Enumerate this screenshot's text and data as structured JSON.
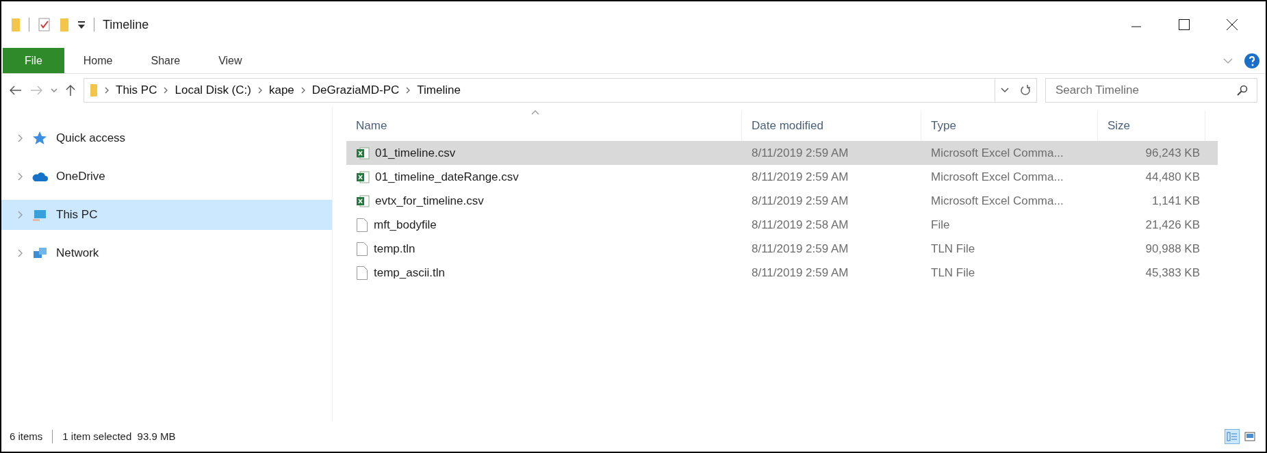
{
  "window": {
    "title": "Timeline"
  },
  "ribbon": {
    "tabs": [
      {
        "label": "File",
        "kind": "file"
      },
      {
        "label": "Home",
        "kind": "tab"
      },
      {
        "label": "Share",
        "kind": "tab"
      },
      {
        "label": "View",
        "kind": "tab"
      }
    ]
  },
  "address_bar": {
    "path": [
      "This PC",
      "Local Disk (C:)",
      "kape",
      "DeGraziaMD-PC",
      "Timeline"
    ]
  },
  "search": {
    "placeholder": "Search Timeline"
  },
  "sidebar": {
    "items": [
      {
        "label": "Quick access",
        "kind": "star",
        "selected": false
      },
      {
        "label": "OneDrive",
        "kind": "cloud",
        "selected": false
      },
      {
        "label": "This PC",
        "kind": "pc",
        "selected": true
      },
      {
        "label": "Network",
        "kind": "network",
        "selected": false
      }
    ]
  },
  "table": {
    "columns": [
      {
        "label": "Name",
        "sorted": true
      },
      {
        "label": "Date modified",
        "sorted": false
      },
      {
        "label": "Type",
        "sorted": false
      },
      {
        "label": "Size",
        "sorted": false
      }
    ],
    "rows": [
      {
        "name": "01_timeline.csv",
        "kind": "excel",
        "date": "8/11/2019 2:59 AM",
        "type": "Microsoft Excel Comma...",
        "size": "96,243 KB",
        "selected": true
      },
      {
        "name": "01_timeline_dateRange.csv",
        "kind": "excel",
        "date": "8/11/2019 2:59 AM",
        "type": "Microsoft Excel Comma...",
        "size": "44,480 KB",
        "selected": false
      },
      {
        "name": "evtx_for_timeline.csv",
        "kind": "excel",
        "date": "8/11/2019 2:59 AM",
        "type": "Microsoft Excel Comma...",
        "size": "1,141 KB",
        "selected": false
      },
      {
        "name": "mft_bodyfile",
        "kind": "file",
        "date": "8/11/2019 2:58 AM",
        "type": "File",
        "size": "21,426 KB",
        "selected": false
      },
      {
        "name": "temp.tln",
        "kind": "file",
        "date": "8/11/2019 2:59 AM",
        "type": "TLN File",
        "size": "90,988 KB",
        "selected": false
      },
      {
        "name": "temp_ascii.tln",
        "kind": "file",
        "date": "8/11/2019 2:59 AM",
        "type": "TLN File",
        "size": "45,383 KB",
        "selected": false
      }
    ]
  },
  "status_bar": {
    "item_count": "6 items",
    "selection": "1 item selected  93.9 MB",
    "views": [
      {
        "kind": "details",
        "selected": true
      },
      {
        "kind": "thumbnails",
        "selected": false
      }
    ]
  }
}
